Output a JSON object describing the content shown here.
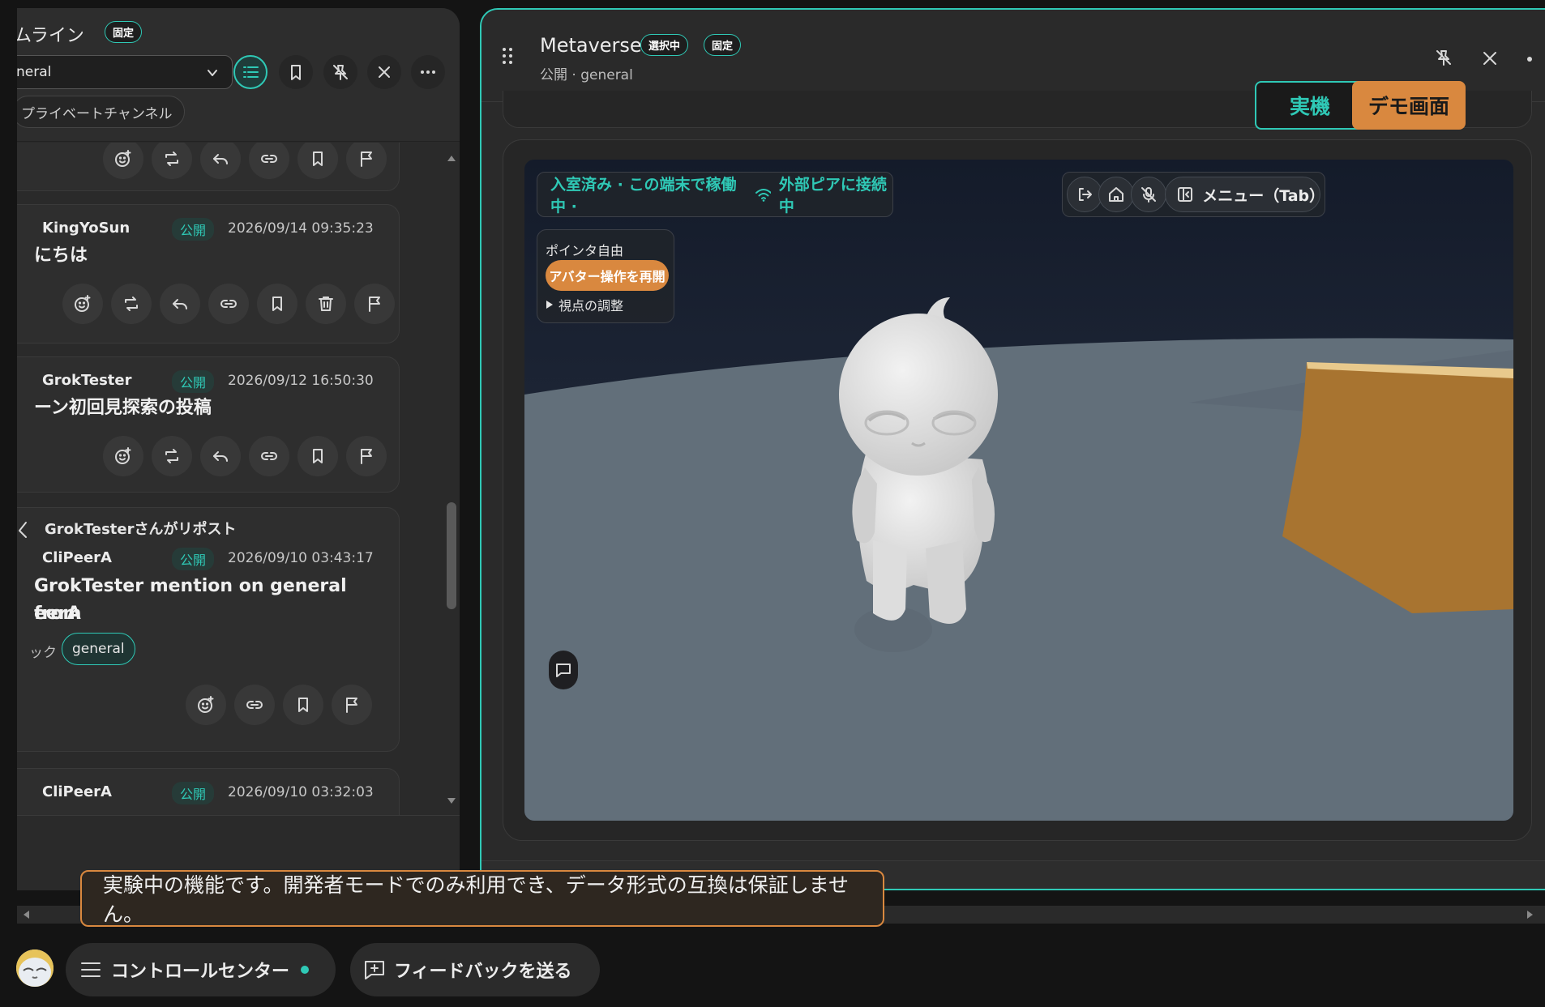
{
  "timeline": {
    "title": "ムライン",
    "fixed_badge": "固定",
    "channel_select": "neral",
    "private_channel": "プライベートチャンネル",
    "posts": [
      {
        "author": "KingYoSun",
        "visibility": "公開",
        "timestamp": "2026/09/14 09:35:23",
        "body": "にちは"
      },
      {
        "author": "GrokTester",
        "visibility": "公開",
        "timestamp": "2026/09/12 16:50:30",
        "body": "ーン初回見探索の投稿"
      },
      {
        "repost_note": "GrokTesterさんがリポスト",
        "author": "CliPeerA",
        "visibility": "公開",
        "timestamp": "2026/09/10 03:43:17",
        "body_line1": "GrokTester mention on general from",
        "body_line2": "eerA",
        "tag_prefix": "ック",
        "tag": "general"
      },
      {
        "author": "CliPeerA",
        "visibility": "公開",
        "timestamp": "2026/09/10 03:32:03"
      }
    ]
  },
  "metaverse": {
    "title": "Metaverse",
    "selected_badge": "選択中",
    "fixed_badge": "固定",
    "subtitle": "公開 · general",
    "real_device": "実機",
    "demo_screen": "デモ画面",
    "status": {
      "prefix": "入室済み · この端末で稼働中 ·",
      "peer": "外部ピアに接続中"
    },
    "menu_label": "メニュー（Tab）",
    "pointer": {
      "label": "ポインタ自由",
      "resume": "アバター操作を再開",
      "view_adjust": "視点の調整"
    }
  },
  "toast": "実験中の機能です。開発者モードでのみ利用でき、データ形式の互換は保証しません。",
  "dock": {
    "control_center": "コントロールセンター",
    "feedback": "フィードバックを送る"
  },
  "colors": {
    "accent": "#2fc9b6",
    "orange": "#d9883f",
    "wall": "#a87430"
  }
}
